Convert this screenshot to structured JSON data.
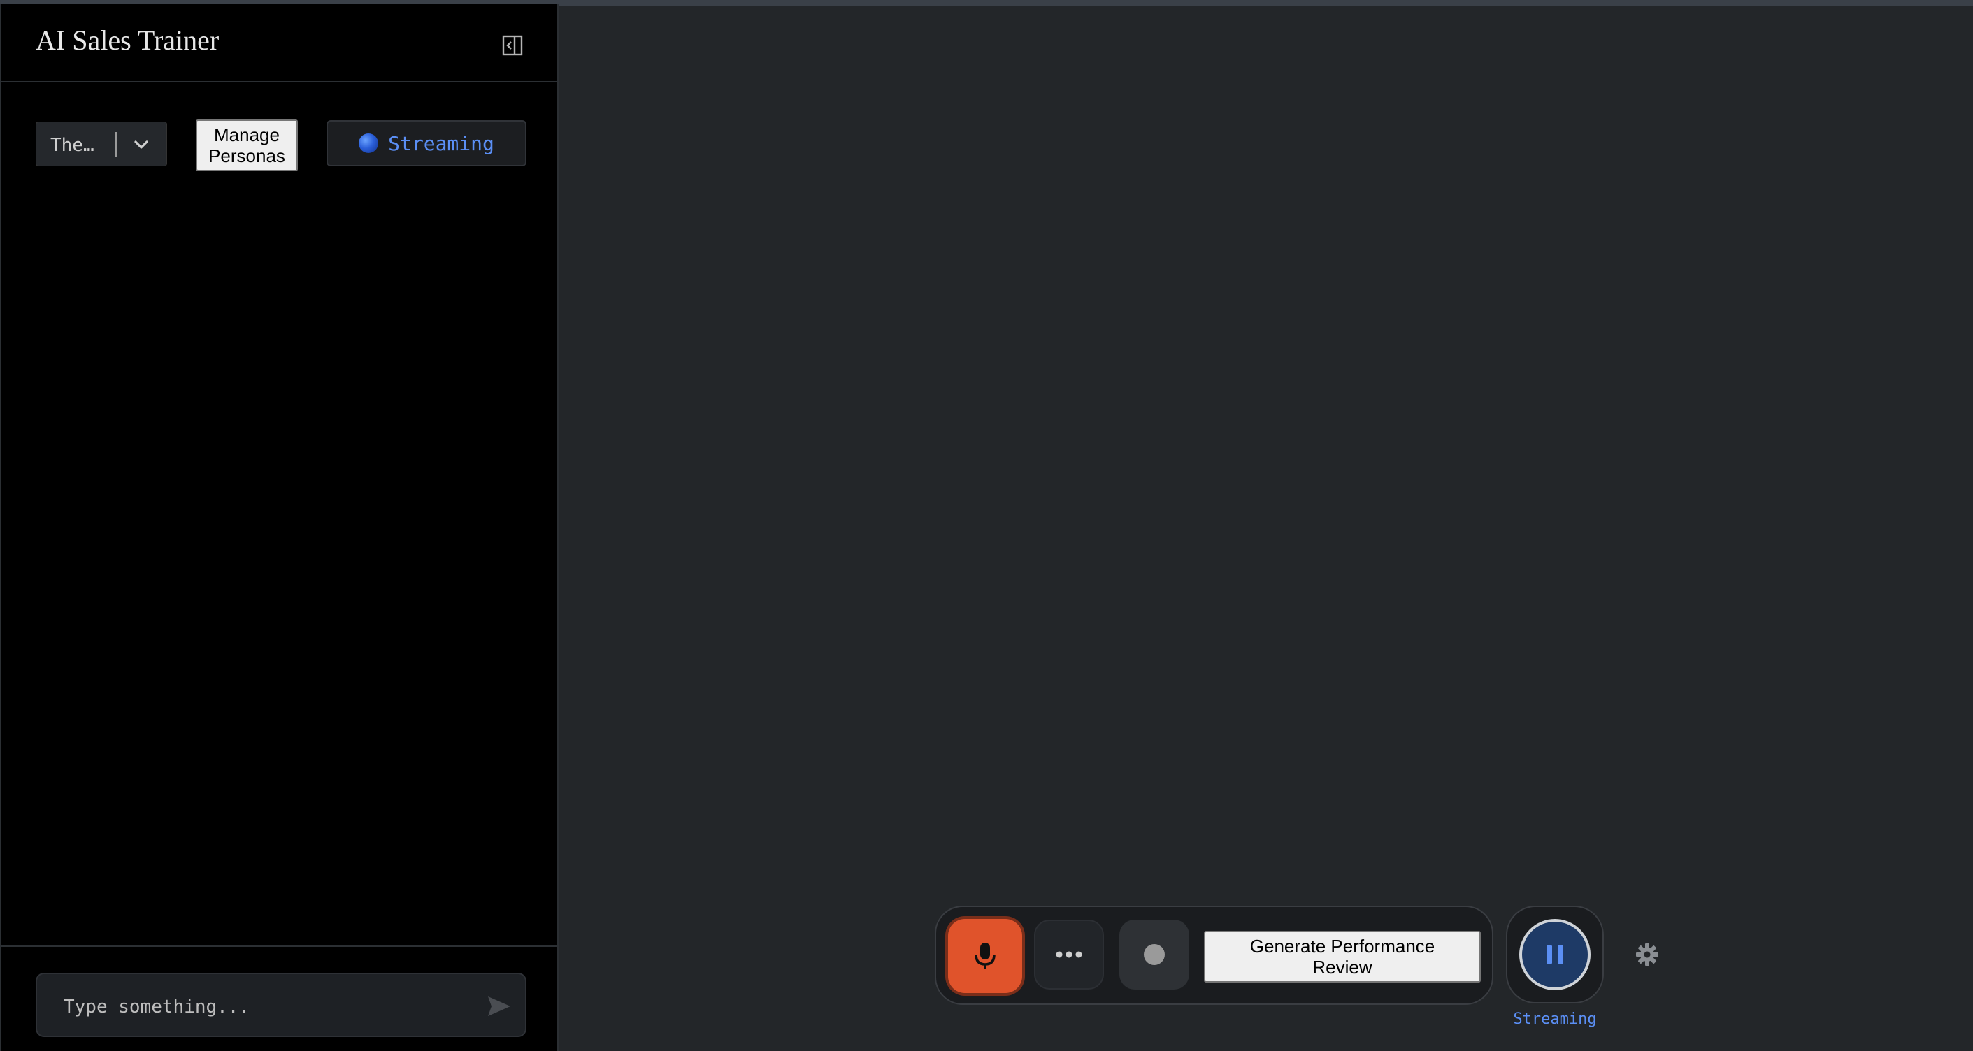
{
  "app": {
    "title": "AI Sales Trainer"
  },
  "sidebar": {
    "persona_select": {
      "selected_value": "The…"
    },
    "manage_personas_label": "Manage Personas",
    "streaming_button_label": "Streaming",
    "message_input": {
      "placeholder": "Type something..."
    }
  },
  "control_bar": {
    "generate_review_label": "Generate Performance Review",
    "pause_caption": "Streaming"
  },
  "colors": {
    "mic_accent": "#e0532b",
    "streaming_accent": "#5b8ff5",
    "pause_fill": "#1e3a66"
  },
  "icons": {
    "collapse": "sidebar-collapse-icon",
    "chevron": "chevron-down-icon",
    "send": "send-icon",
    "mic": "microphone-icon",
    "more": "more-horizontal-icon",
    "record": "record-icon",
    "pause": "pause-icon",
    "settings": "gear-icon"
  }
}
